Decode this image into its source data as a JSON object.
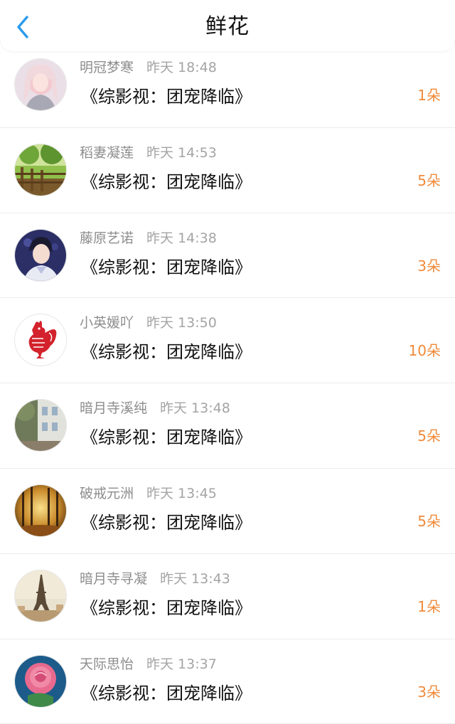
{
  "header": {
    "title": "鲜花",
    "back_icon": "chevron-left-icon",
    "accent": "#2a9bec"
  },
  "colors": {
    "count": "#f08a3a",
    "meta": "#9a9a9a"
  },
  "items": [
    {
      "name": "明冠梦寒",
      "time": "昨天 18:48",
      "book": "《综影视：团宠降临》",
      "count": "1朵",
      "avatar": "girl-portrait"
    },
    {
      "name": "稻妻凝莲",
      "time": "昨天 14:53",
      "book": "《综影视：团宠降临》",
      "count": "5朵",
      "avatar": "garden-fence"
    },
    {
      "name": "藤原艺诺",
      "time": "昨天 14:38",
      "book": "《综影视：团宠降临》",
      "count": "3朵",
      "avatar": "boy-portrait"
    },
    {
      "name": "小英媛吖",
      "time": "昨天 13:50",
      "book": "《综影视：团宠降临》",
      "count": "10朵",
      "avatar": "red-rooster-papercut"
    },
    {
      "name": "暗月寺溪纯",
      "time": "昨天 13:48",
      "book": "《综影视：团宠降临》",
      "count": "5朵",
      "avatar": "street-building"
    },
    {
      "name": "破戒元洲",
      "time": "昨天 13:45",
      "book": "《综影视：团宠降临》",
      "count": "5朵",
      "avatar": "autumn-forest"
    },
    {
      "name": "暗月寺寻凝",
      "time": "昨天 13:43",
      "book": "《综影视：团宠降临》",
      "count": "1朵",
      "avatar": "eiffel-tower"
    },
    {
      "name": "天际思怡",
      "time": "昨天 13:37",
      "book": "《综影视：团宠降临》",
      "count": "3朵",
      "avatar": "pink-rose"
    }
  ]
}
